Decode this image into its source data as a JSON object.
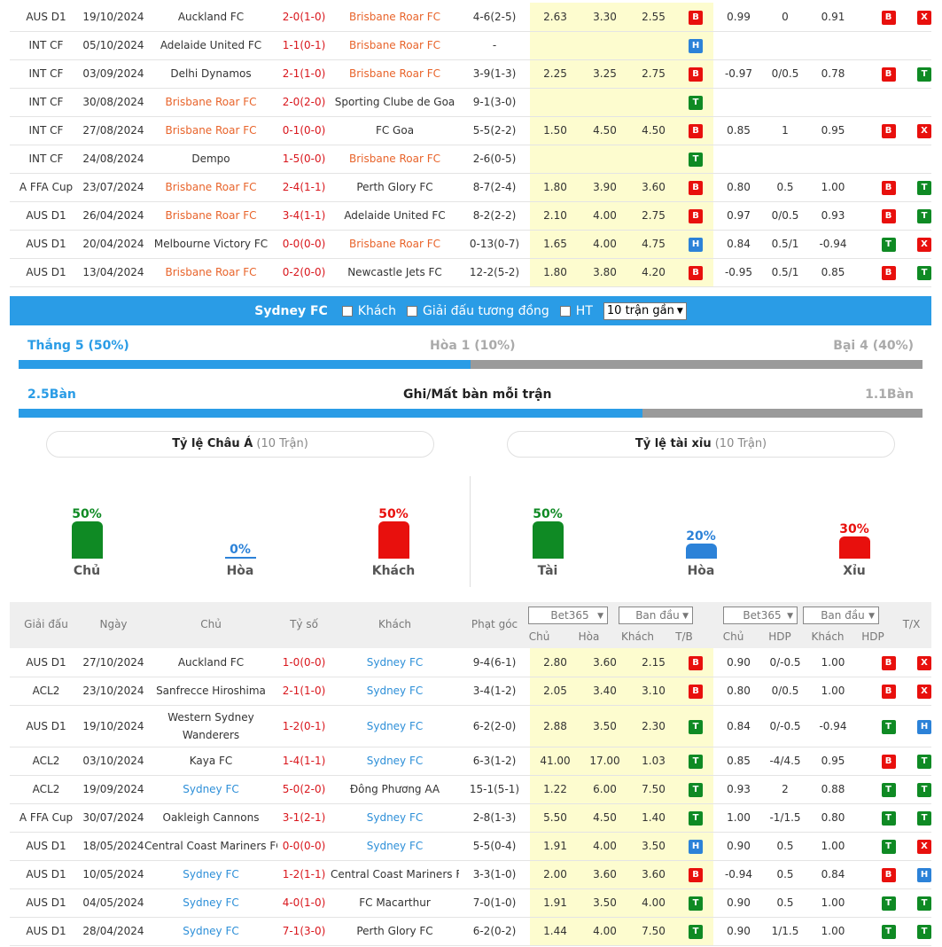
{
  "top_rows": [
    [
      "AUS D1",
      "19/10/2024",
      "Auckland FC",
      "2-0(1-0)",
      "Brisbane Roar FC",
      "4-6(2-5)",
      "2.63",
      "3.30",
      "2.55",
      "B",
      "0.99",
      "0",
      "0.91",
      "B",
      "X"
    ],
    [
      "INT CF",
      "05/10/2024",
      "Adelaide United FC",
      "1-1(0-1)",
      "Brisbane Roar FC",
      "-",
      "",
      "",
      "",
      "H",
      "",
      "",
      "",
      "",
      ""
    ],
    [
      "INT CF",
      "03/09/2024",
      "Delhi Dynamos",
      "2-1(1-0)",
      "Brisbane Roar FC",
      "3-9(1-3)",
      "2.25",
      "3.25",
      "2.75",
      "B",
      "-0.97",
      "0/0.5",
      "0.78",
      "B",
      "T"
    ],
    [
      "INT CF",
      "30/08/2024",
      "Brisbane Roar FC",
      "2-0(2-0)",
      "Sporting Clube de Goa",
      "9-1(3-0)",
      "",
      "",
      "",
      "T",
      "",
      "",
      "",
      "",
      ""
    ],
    [
      "INT CF",
      "27/08/2024",
      "Brisbane Roar FC",
      "0-1(0-0)",
      "FC Goa",
      "5-5(2-2)",
      "1.50",
      "4.50",
      "4.50",
      "B",
      "0.85",
      "1",
      "0.95",
      "B",
      "X"
    ],
    [
      "INT CF",
      "24/08/2024",
      "Dempo",
      "1-5(0-0)",
      "Brisbane Roar FC",
      "2-6(0-5)",
      "",
      "",
      "",
      "T",
      "",
      "",
      "",
      "",
      ""
    ],
    [
      "A FFA Cup",
      "23/07/2024",
      "Brisbane Roar FC",
      "2-4(1-1)",
      "Perth Glory FC",
      "8-7(2-4)",
      "1.80",
      "3.90",
      "3.60",
      "B",
      "0.80",
      "0.5",
      "1.00",
      "B",
      "T"
    ],
    [
      "AUS D1",
      "26/04/2024",
      "Brisbane Roar FC",
      "3-4(1-1)",
      "Adelaide United FC",
      "8-2(2-2)",
      "2.10",
      "4.00",
      "2.75",
      "B",
      "0.97",
      "0/0.5",
      "0.93",
      "B",
      "T"
    ],
    [
      "AUS D1",
      "20/04/2024",
      "Melbourne Victory FC",
      "0-0(0-0)",
      "Brisbane Roar FC",
      "0-13(0-7)",
      "1.65",
      "4.00",
      "4.75",
      "H",
      "0.84",
      "0.5/1",
      "-0.94",
      "T",
      "X"
    ],
    [
      "AUS D1",
      "13/04/2024",
      "Brisbane Roar FC",
      "0-2(0-0)",
      "Newcastle Jets FC",
      "12-2(5-2)",
      "1.80",
      "3.80",
      "4.20",
      "B",
      "-0.95",
      "0.5/1",
      "0.85",
      "B",
      "T"
    ]
  ],
  "filter": {
    "team": "Sydney FC",
    "opt_away": "Khách",
    "opt_same_league": "Giải đấu tương đồng",
    "opt_ht": "HT",
    "select_value": "10 trận gần"
  },
  "summary": {
    "win": "Thắng 5 (50%)",
    "draw": "Hòa 1 (10%)",
    "loss": "Bại 4 (40%)",
    "win_ratio": 0.5,
    "goals_for": "2.5Bàn",
    "goals_title": "Ghi/Mất bàn mỗi trận",
    "goals_against": "1.1Bàn",
    "goals_ratio": 0.69
  },
  "asian": {
    "title": "Tỷ lệ Châu Á",
    "count": "(10 Trận)",
    "items": [
      {
        "pct": "50%",
        "label": "Chủ",
        "color": "#0f8a24",
        "value": 50
      },
      {
        "pct": "0%",
        "label": "Hòa",
        "color": "#2c82d8",
        "value": 0
      },
      {
        "pct": "50%",
        "label": "Khách",
        "color": "#e8100d",
        "value": 50
      }
    ]
  },
  "overunder": {
    "title": "Tỷ lệ tài xỉu",
    "count": "(10 Trận)",
    "items": [
      {
        "pct": "50%",
        "label": "Tài",
        "color": "#0f8a24",
        "value": 50
      },
      {
        "pct": "20%",
        "label": "Hòa",
        "color": "#2c82d8",
        "value": 20
      },
      {
        "pct": "30%",
        "label": "Xỉu",
        "color": "#e8100d",
        "value": 30
      }
    ]
  },
  "header": {
    "league": "Giải đấu",
    "date": "Ngày",
    "home": "Chủ",
    "score": "Tỷ số",
    "away": "Khách",
    "corners": "Phạt góc",
    "bookmaker1": "Bet365",
    "type1": "Ban đầu",
    "bookmaker2": "Bet365",
    "type2": "Ban đầu",
    "tx": "T/X",
    "sub_home": "Chủ",
    "sub_draw": "Hòa",
    "sub_away": "Khách",
    "sub_tb": "T/B",
    "sub_home2": "Chủ",
    "sub_hdp": "HDP",
    "sub_away2": "Khách",
    "sub_hdp2": "HDP"
  },
  "bottom_rows": [
    [
      "AUS D1",
      "27/10/2024",
      "Auckland FC",
      "1-0(0-0)",
      "Sydney FC",
      "9-4(6-1)",
      "2.80",
      "3.60",
      "2.15",
      "B",
      "0.90",
      "0/-0.5",
      "1.00",
      "B",
      "X"
    ],
    [
      "ACL2",
      "23/10/2024",
      "Sanfrecce Hiroshima",
      "2-1(1-0)",
      "Sydney FC",
      "3-4(1-2)",
      "2.05",
      "3.40",
      "3.10",
      "B",
      "0.80",
      "0/0.5",
      "1.00",
      "B",
      "X"
    ],
    [
      "AUS D1",
      "19/10/2024",
      "Western Sydney Wanderers",
      "1-2(0-1)",
      "Sydney FC",
      "6-2(2-0)",
      "2.88",
      "3.50",
      "2.30",
      "T",
      "0.84",
      "0/-0.5",
      "-0.94",
      "T",
      "H"
    ],
    [
      "ACL2",
      "03/10/2024",
      "Kaya FC",
      "1-4(1-1)",
      "Sydney FC",
      "6-3(1-2)",
      "41.00",
      "17.00",
      "1.03",
      "T",
      "0.85",
      "-4/4.5",
      "0.95",
      "B",
      "T"
    ],
    [
      "ACL2",
      "19/09/2024",
      "Sydney FC",
      "5-0(2-0)",
      "Đông Phương AA",
      "15-1(5-1)",
      "1.22",
      "6.00",
      "7.50",
      "T",
      "0.93",
      "2",
      "0.88",
      "T",
      "T"
    ],
    [
      "A FFA Cup",
      "30/07/2024",
      "Oakleigh Cannons",
      "3-1(2-1)",
      "Sydney FC",
      "2-8(1-3)",
      "5.50",
      "4.50",
      "1.40",
      "T",
      "1.00",
      "-1/1.5",
      "0.80",
      "T",
      "T"
    ],
    [
      "AUS D1",
      "18/05/2024",
      "Central Coast Mariners FC",
      "0-0(0-0)",
      "Sydney FC",
      "5-5(0-4)",
      "1.91",
      "4.00",
      "3.50",
      "H",
      "0.90",
      "0.5",
      "1.00",
      "T",
      "X"
    ],
    [
      "AUS D1",
      "10/05/2024",
      "Sydney FC",
      "1-2(1-1)",
      "Central Coast Mariners FC",
      "3-3(1-0)",
      "2.00",
      "3.60",
      "3.60",
      "B",
      "-0.94",
      "0.5",
      "0.84",
      "B",
      "H"
    ],
    [
      "AUS D1",
      "04/05/2024",
      "Sydney FC",
      "4-0(1-0)",
      "FC Macarthur",
      "7-0(1-0)",
      "1.91",
      "3.50",
      "4.00",
      "T",
      "0.90",
      "0.5",
      "1.00",
      "T",
      "T"
    ],
    [
      "AUS D1",
      "28/04/2024",
      "Sydney FC",
      "7-1(3-0)",
      "Perth Glory FC",
      "6-2(0-2)",
      "1.44",
      "4.00",
      "7.50",
      "T",
      "0.90",
      "1/1.5",
      "1.00",
      "T",
      "T"
    ]
  ],
  "colors": {
    "brisbane": "#e8642b",
    "sydney": "#2d8fd8",
    "bar_blue": "#2a9ce6",
    "bar_grey": "#9a9a9a",
    "badge_B": "#e8100d",
    "badge_T": "#0f8a24",
    "badge_H": "#2c82d8",
    "badge_X": "#e8100d"
  }
}
